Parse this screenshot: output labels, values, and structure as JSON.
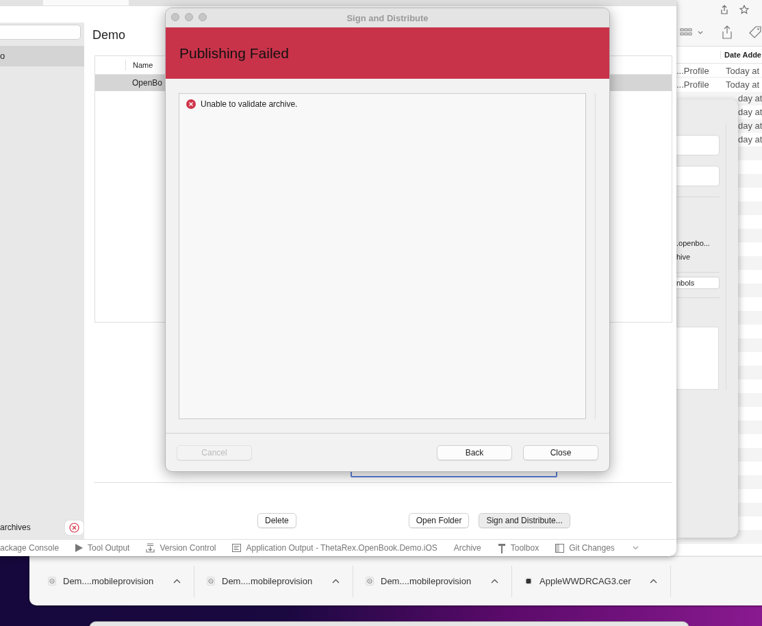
{
  "ide_window": {
    "sidebar": {
      "items": [
        {
          "label": "o",
          "selected": true
        }
      ],
      "footer_label": "archives"
    },
    "page_title": "Demo",
    "table": {
      "columns": [
        "Name"
      ],
      "rows": [
        {
          "cells": [
            "OpenBo"
          ],
          "selected": true
        }
      ]
    },
    "buttons": [
      {
        "label": "Delete",
        "default": false
      },
      {
        "label": "Open Folder",
        "default": false
      },
      {
        "label": "Sign and Distribute...",
        "default": true
      }
    ],
    "pads": [
      {
        "label": "ackage Console",
        "kind": "plain"
      },
      {
        "label": "Tool Output",
        "kind": "play"
      },
      {
        "label": "Version Control",
        "kind": "tray"
      },
      {
        "label": "Application Output - ThetaRex.OpenBook.Demo.iOS",
        "kind": "console"
      },
      {
        "label": "Archive",
        "kind": "plain"
      },
      {
        "label": "Toolbox",
        "kind": "hammer"
      },
      {
        "label": "Git Changes",
        "kind": "panel"
      }
    ]
  },
  "dialog": {
    "title": "Sign and Distribute",
    "heading": "Publishing Failed",
    "messages": [
      {
        "kind": "error",
        "text": "Unable to validate archive."
      }
    ],
    "buttons": [
      {
        "label": "Cancel",
        "disabled": true
      },
      {
        "label": "Back",
        "disabled": false
      },
      {
        "label": "Close",
        "disabled": false
      }
    ]
  },
  "finder": {
    "column": "Date Adde",
    "rows": [
      {
        "kind": "...Profile",
        "date": "Today at"
      },
      {
        "kind": "...Profile",
        "date": "Today at"
      },
      {
        "date": "day at"
      },
      {
        "date": "day at"
      },
      {
        "date": "day at"
      },
      {
        "date": "day at"
      }
    ]
  },
  "inspector": {
    "lines": [
      ".openbo...",
      "hive"
    ],
    "button": "nbols"
  },
  "downloads": [
    {
      "name": "Dem....mobileprovision",
      "kind": "profile"
    },
    {
      "name": "Dem....mobileprovision",
      "kind": "profile"
    },
    {
      "name": "Dem....mobileprovision",
      "kind": "profile"
    },
    {
      "name": "AppleWWDRCAG3.cer",
      "kind": "certificate"
    }
  ]
}
